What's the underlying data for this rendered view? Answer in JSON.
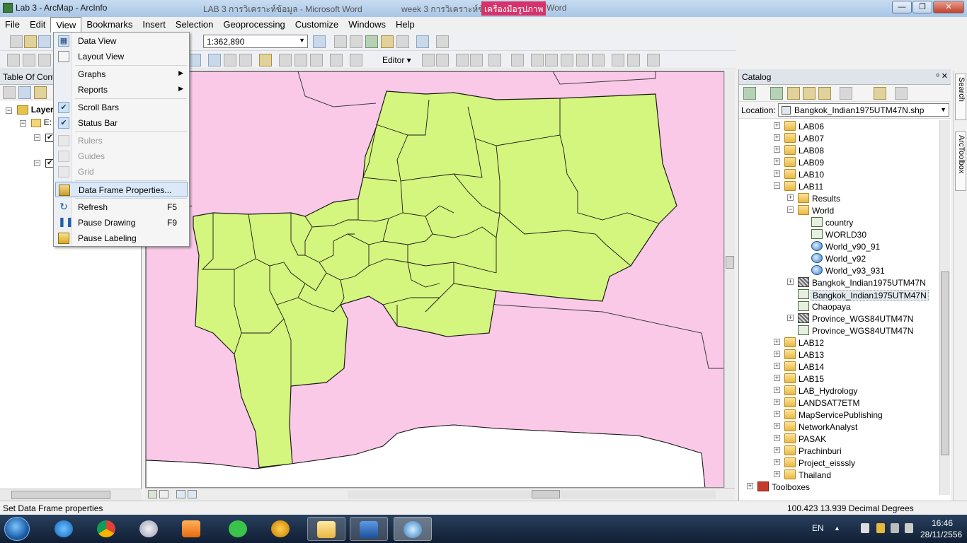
{
  "titlebar": {
    "title": "Lab 3 - ArcMap - ArcInfo",
    "bg_word_title": "LAB 3 การวิเคราะห์ข้อมูล - Microsoft Word",
    "bg_word_title2": "week 3 การวิเคราะห์ข้",
    "bg_picture_tools": "เครื่องมือรูปภาพ",
    "bg_word_suffix": "Word",
    "minimize": "—",
    "restore": "❐",
    "close": "✕"
  },
  "menubar": [
    "File",
    "Edit",
    "View",
    "Bookmarks",
    "Insert",
    "Selection",
    "Geoprocessing",
    "Customize",
    "Windows",
    "Help"
  ],
  "toolbar": {
    "scale": "1:362,890",
    "editor": "Editor ▾"
  },
  "toc": {
    "title": "Table Of Contents",
    "layers_label": "Layers",
    "e_label": "E:"
  },
  "view_menu": {
    "items": [
      {
        "label": "Data View",
        "shortcut": ""
      },
      {
        "label": "Layout View",
        "shortcut": ""
      },
      {
        "label": "Graphs",
        "shortcut": ""
      },
      {
        "label": "Reports",
        "shortcut": ""
      },
      {
        "label": "Scroll Bars",
        "shortcut": ""
      },
      {
        "label": "Status Bar",
        "shortcut": ""
      },
      {
        "label": "Rulers",
        "shortcut": ""
      },
      {
        "label": "Guides",
        "shortcut": ""
      },
      {
        "label": "Grid",
        "shortcut": ""
      },
      {
        "label": "Data Frame Properties...",
        "shortcut": ""
      },
      {
        "label": "Refresh",
        "shortcut": "F5"
      },
      {
        "label": "Pause Drawing",
        "shortcut": "F9"
      },
      {
        "label": "Pause Labeling",
        "shortcut": ""
      }
    ]
  },
  "catalog": {
    "title": "Catalog",
    "pin": "ᵒ",
    "close": "✕",
    "location_label": "Location:",
    "location_value": "Bangkok_Indian1975UTM47N.shp",
    "tree": [
      {
        "label": "LAB06"
      },
      {
        "label": "LAB07"
      },
      {
        "label": "LAB08"
      },
      {
        "label": "LAB09"
      },
      {
        "label": "LAB10"
      },
      {
        "label": "LAB11"
      },
      {
        "label": "Results"
      },
      {
        "label": "World"
      },
      {
        "label": "country"
      },
      {
        "label": "WORLD30"
      },
      {
        "label": "World_v90_91"
      },
      {
        "label": "World_v92"
      },
      {
        "label": "World_v93_931"
      },
      {
        "label": "Bangkok_Indian1975UTM47N"
      },
      {
        "label": "Bangkok_Indian1975UTM47N"
      },
      {
        "label": "Chaopaya"
      },
      {
        "label": "Province_WGS84UTM47N"
      },
      {
        "label": "Province_WGS84UTM47N"
      },
      {
        "label": "LAB12"
      },
      {
        "label": "LAB13"
      },
      {
        "label": "LAB14"
      },
      {
        "label": "LAB15"
      },
      {
        "label": "LAB_Hydrology"
      },
      {
        "label": "LANDSAT7ETM"
      },
      {
        "label": "MapServicePublishing"
      },
      {
        "label": "NetworkAnalyst"
      },
      {
        "label": "PASAK"
      },
      {
        "label": "Prachinburi"
      },
      {
        "label": "Project_eisssly"
      },
      {
        "label": "Thailand"
      },
      {
        "label": "Toolboxes"
      }
    ]
  },
  "side_tabs": {
    "search": "Search",
    "toolbox": "ArcToolbox"
  },
  "status": {
    "message": "Set Data Frame properties",
    "coords": "100.423  13.939 Decimal Degrees"
  },
  "taskbar": {
    "lang": "EN",
    "time": "16:46",
    "date": "28/11/2556"
  },
  "colors": {
    "province_fill": "#fac9e8",
    "bangkok_fill": "#d4f57e",
    "border": "#1a1a1a"
  }
}
